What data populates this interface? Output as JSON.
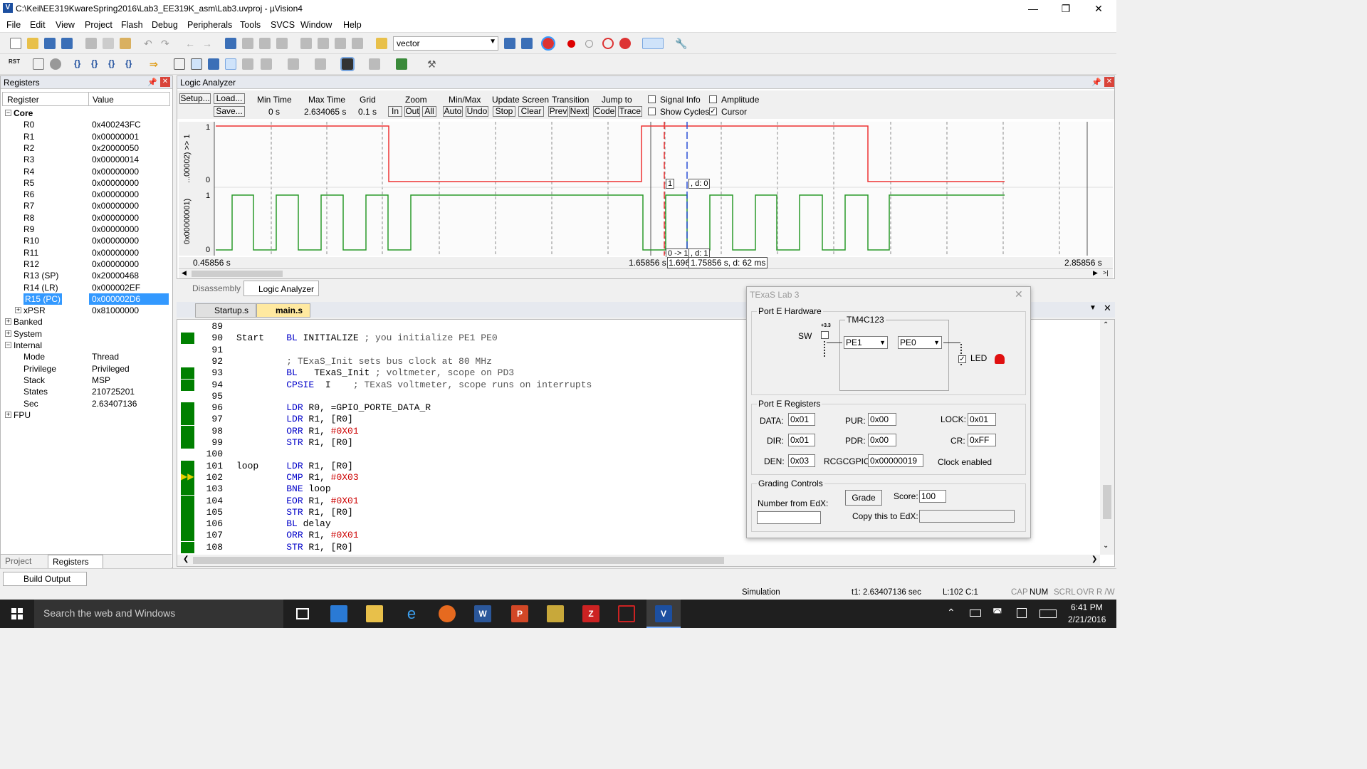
{
  "window": {
    "title": "C:\\Keil\\EE319KwareSpring2016\\Lab3_EE319K_asm\\Lab3.uvproj - µVision4",
    "app_icon": "V"
  },
  "menu": [
    "File",
    "Edit",
    "View",
    "Project",
    "Flash",
    "Debug",
    "Peripherals",
    "Tools",
    "SVCS",
    "Window",
    "Help"
  ],
  "toolbar": {
    "target_combo": "vector"
  },
  "registers": {
    "title": "Registers",
    "col_register": "Register",
    "col_value": "Value",
    "core_label": "Core",
    "rows": [
      [
        "R0",
        "0x400243FC"
      ],
      [
        "R1",
        "0x00000001"
      ],
      [
        "R2",
        "0x20000050"
      ],
      [
        "R3",
        "0x00000014"
      ],
      [
        "R4",
        "0x00000000"
      ],
      [
        "R5",
        "0x00000000"
      ],
      [
        "R6",
        "0x00000000"
      ],
      [
        "R7",
        "0x00000000"
      ],
      [
        "R8",
        "0x00000000"
      ],
      [
        "R9",
        "0x00000000"
      ],
      [
        "R10",
        "0x00000000"
      ],
      [
        "R11",
        "0x00000000"
      ],
      [
        "R12",
        "0x00000000"
      ],
      [
        "R13 (SP)",
        "0x20000468"
      ],
      [
        "R14 (LR)",
        "0x000002EF"
      ],
      [
        "R15 (PC)",
        "0x000002D6"
      ],
      [
        "xPSR",
        "0x81000000"
      ]
    ],
    "groups": [
      "Banked",
      "System",
      "Internal"
    ],
    "internal": [
      [
        "Mode",
        "Thread"
      ],
      [
        "Privilege",
        "Privileged"
      ],
      [
        "Stack",
        "MSP"
      ],
      [
        "States",
        "210725201"
      ],
      [
        "Sec",
        "2.63407136"
      ]
    ],
    "fpu": "FPU",
    "tabs": [
      "Project",
      "Registers"
    ]
  },
  "logic": {
    "title": "Logic Analyzer",
    "setup": "Setup...",
    "load": "Load...",
    "save": "Save...",
    "min_time_label": "Min Time",
    "min_time": "0 s",
    "max_time_label": "Max Time",
    "max_time": "2.634065 s",
    "grid_label": "Grid",
    "grid": "0.1 s",
    "zoom_label": "Zoom",
    "zoom_in": "In",
    "zoom_out": "Out",
    "zoom_all": "All",
    "minmax_label": "Min/Max",
    "auto": "Auto",
    "undo": "Undo",
    "update_label": "Update Screen",
    "stop": "Stop",
    "clear": "Clear",
    "transition_label": "Transition",
    "prev": "Prev",
    "next": "Next",
    "jump_label": "Jump to",
    "code": "Code",
    "trace": "Trace",
    "signal_info": "Signal Info",
    "show_cycles": "Show Cycles",
    "amplitude": "Amplitude",
    "cursor": "Cursor",
    "sig1": "...00002) >> 1",
    "sig2": "0x00000001)",
    "hi": "1",
    "lo": "0",
    "t_start": "0.45856 s",
    "t_cursor": "1.65856 s",
    "t_mid": "1.696",
    "t_delta": "1.75856 s,  d: 62 ms",
    "t_end": "2.85856 s",
    "marker1": "1",
    "marker1b": ", d: 0",
    "marker2": "0 -> 1",
    "marker2b": ", d: 1",
    "tabs": [
      "Disassembly",
      "Logic Analyzer"
    ]
  },
  "editor": {
    "tabs": [
      "Startup.s",
      "main.s"
    ],
    "lines": [
      {
        "n": "89",
        "t": "",
        "g": false
      },
      {
        "n": "90",
        "t": "Start    BL INITIALIZE ; you initialize PE1 PE0",
        "g": true
      },
      {
        "n": "91",
        "t": "",
        "g": false
      },
      {
        "n": "92",
        "t": "         ; TExaS_Init sets bus clock at 80 MHz",
        "g": false
      },
      {
        "n": "93",
        "t": "         BL   TExaS_Init ; voltmeter, scope on PD3",
        "g": true
      },
      {
        "n": "94",
        "t": "         CPSIE  I    ; TExaS voltmeter, scope runs on interrupts",
        "g": true
      },
      {
        "n": "95",
        "t": "",
        "g": false
      },
      {
        "n": "96",
        "t": "         LDR R0, =GPIO_PORTE_DATA_R",
        "g": true
      },
      {
        "n": "97",
        "t": "         LDR R1, [R0]",
        "g": true
      },
      {
        "n": "98",
        "t": "         ORR R1, #0X01",
        "g": true
      },
      {
        "n": "99",
        "t": "         STR R1, [R0]",
        "g": true
      },
      {
        "n": "100",
        "t": "",
        "g": false
      },
      {
        "n": "101",
        "t": "loop     LDR R1, [R0]",
        "g": true
      },
      {
        "n": "102",
        "t": "         CMP R1, #0X03",
        "g": true
      },
      {
        "n": "103",
        "t": "         BNE loop",
        "g": true
      },
      {
        "n": "104",
        "t": "         EOR R1, #0X01",
        "g": true
      },
      {
        "n": "105",
        "t": "         STR R1, [R0]",
        "g": true
      },
      {
        "n": "106",
        "t": "         BL delay",
        "g": true
      },
      {
        "n": "107",
        "t": "         ORR R1, #0X01",
        "g": true
      },
      {
        "n": "108",
        "t": "         STR R1, [R0]",
        "g": true
      }
    ]
  },
  "texas": {
    "title": "TExaS Lab 3",
    "hw_group": "Port E Hardware",
    "chip": "TM4C123",
    "sw": "SW",
    "v33": "+3.3",
    "pe1": "PE1",
    "pe0": "PE0",
    "led": "LED",
    "reg_group": "Port E Registers",
    "data_l": "DATA:",
    "data": "0x01",
    "pur_l": "PUR:",
    "pur": "0x00",
    "lock_l": "LOCK:",
    "lock": "0x01",
    "dir_l": "DIR:",
    "dir": "0x01",
    "pdr_l": "PDR:",
    "pdr": "0x00",
    "cr_l": "CR:",
    "cr": "0xFF",
    "den_l": "DEN:",
    "den": "0x03",
    "rcgc_l": "RCGCGPIO:",
    "rcgc": "0x00000019",
    "clock": "Clock enabled",
    "grade_group": "Grading Controls",
    "grade": "Grade",
    "score_l": "Score:",
    "score": "100",
    "edx_l": "Number from EdX:",
    "copy_l": "Copy this to EdX:"
  },
  "build_output": "Build Output",
  "status": {
    "mode": "Simulation",
    "t1": "t1: 2.63407136 sec",
    "pos": "L:102 C:1",
    "caps": "CAP",
    "num": "NUM",
    "scrl": "SCRL",
    "ovr": "OVR",
    "rw": "R /W"
  },
  "taskbar": {
    "search": "Search the web and Windows",
    "time": "6:41 PM",
    "date": "2/21/2016"
  }
}
